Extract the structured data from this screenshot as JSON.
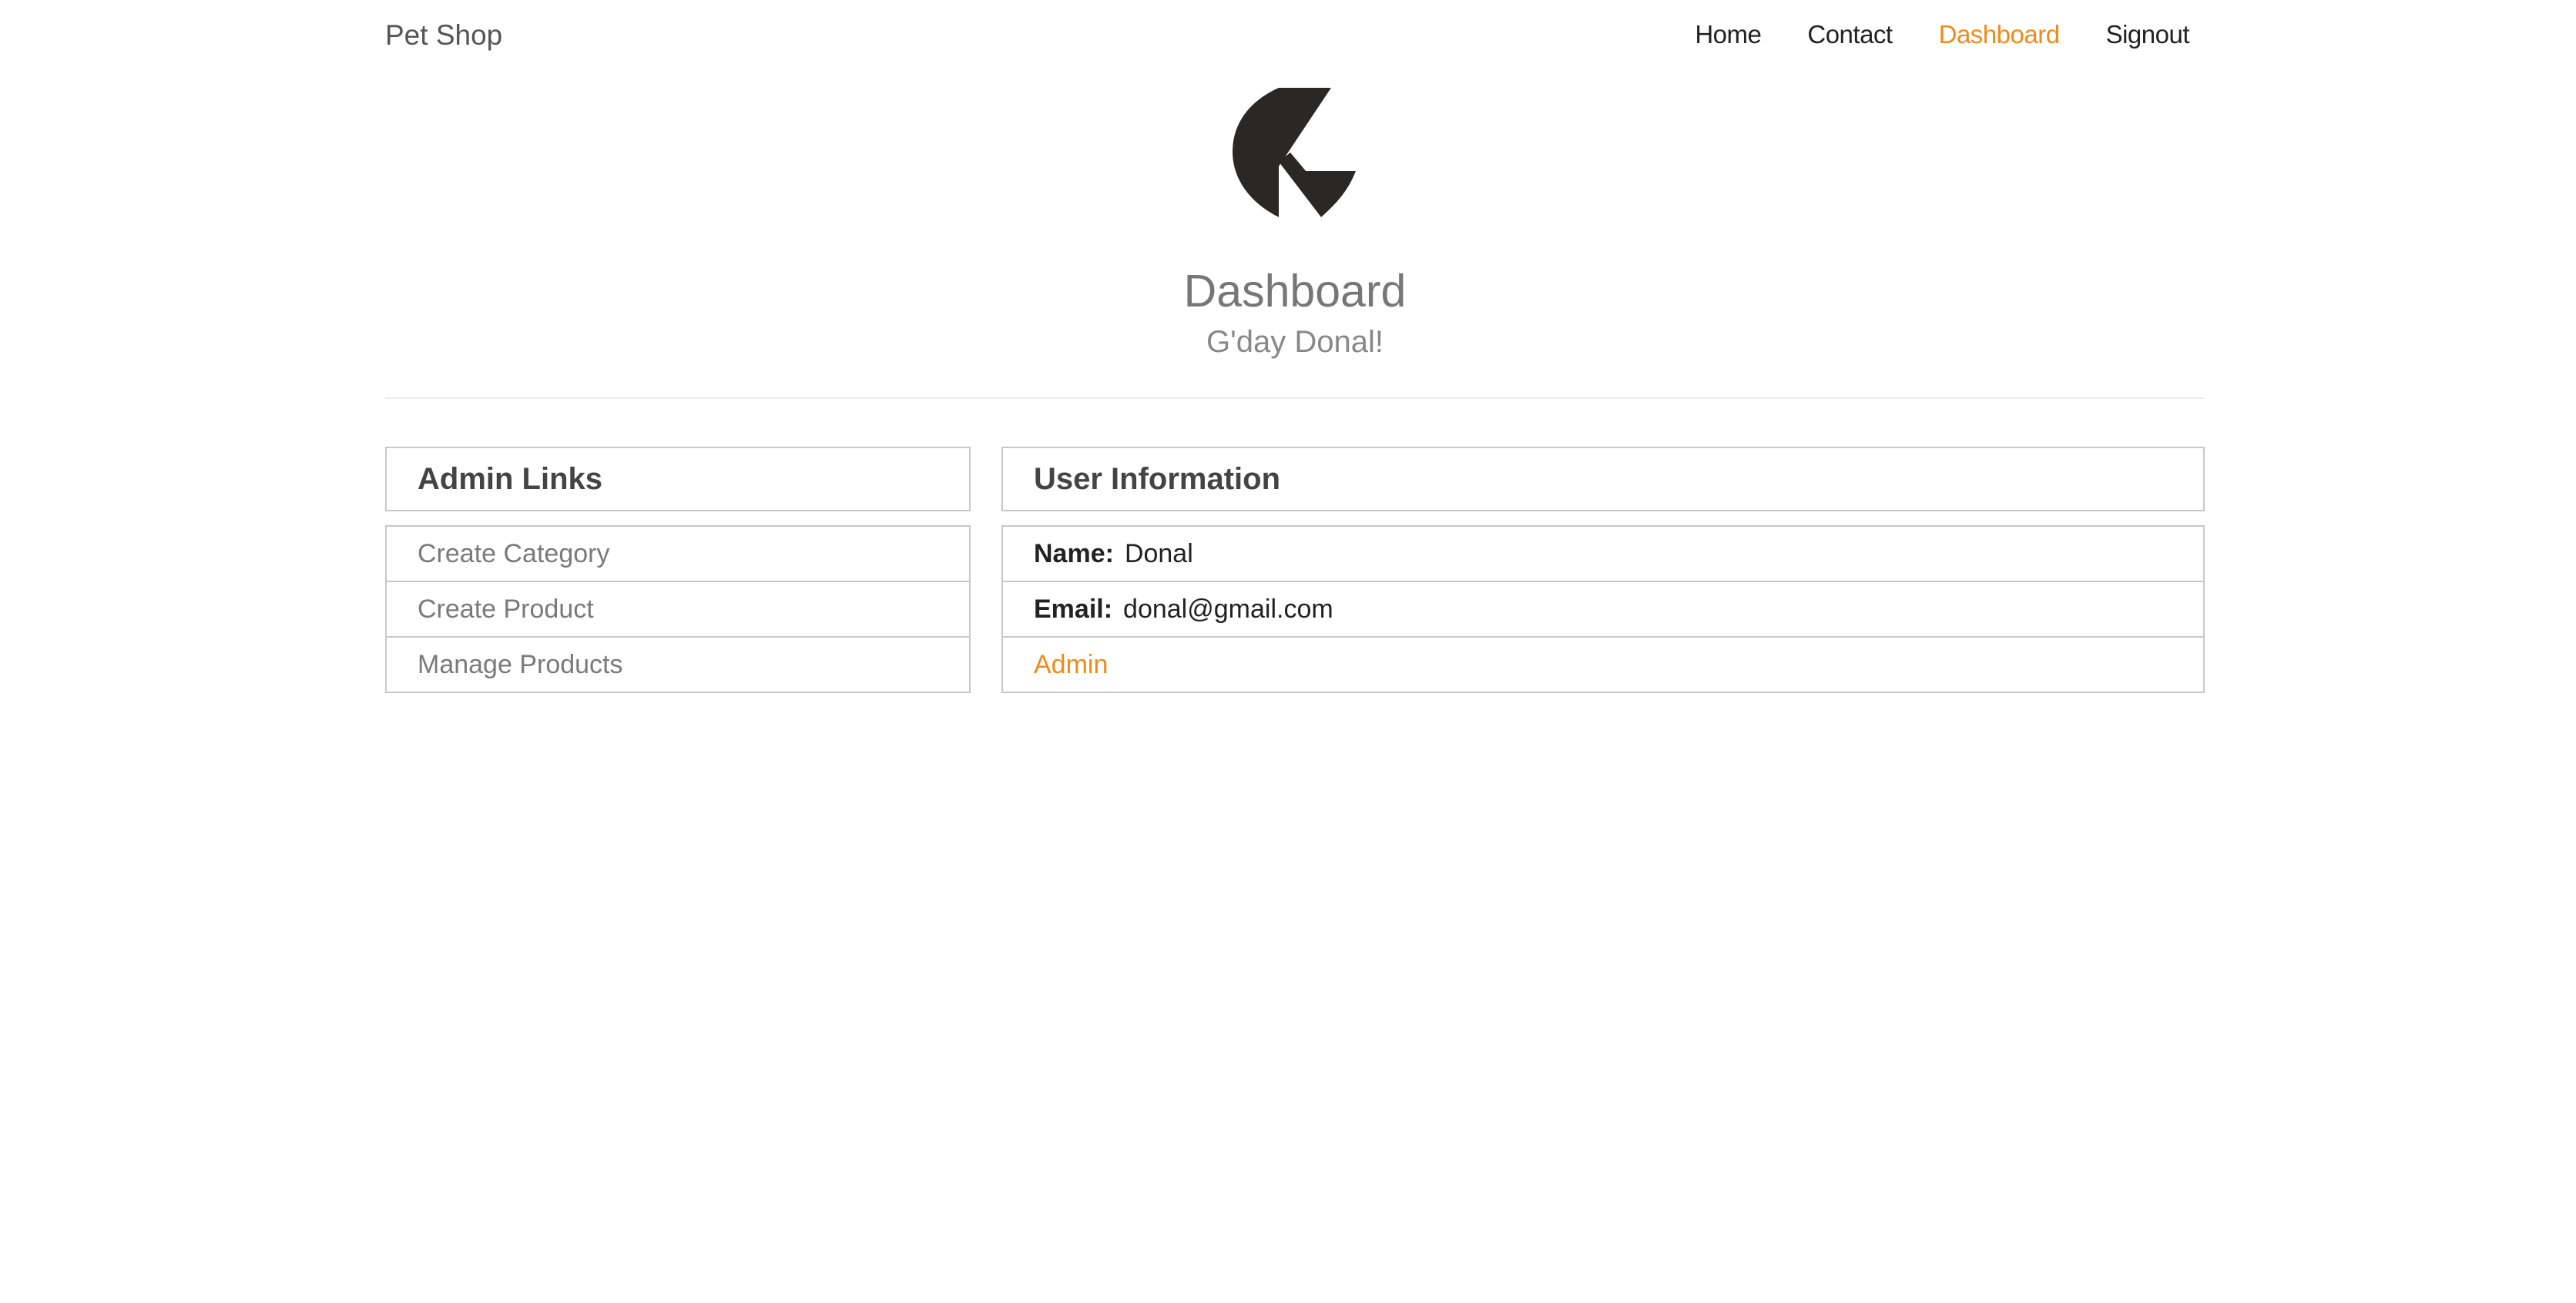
{
  "navbar": {
    "brand": "Pet Shop",
    "links": [
      "Home",
      "Contact",
      "Dashboard",
      "Signout"
    ],
    "active": "Dashboard"
  },
  "header": {
    "logo_icon": "k-logo-icon",
    "title": "Dashboard",
    "greeting": "G'day Donal!"
  },
  "admin_links": {
    "title": "Admin Links",
    "items": [
      "Create Category",
      "Create Product",
      "Manage Products"
    ]
  },
  "user_info": {
    "title": "User Information",
    "name_label": "Name:",
    "name": "Donal",
    "email_label": "Email:",
    "email": "donal@gmail.com",
    "role": "Admin"
  },
  "colors": {
    "accent": "#f08a1c",
    "border": "#c8c8c8",
    "logo": "#2a2826"
  }
}
